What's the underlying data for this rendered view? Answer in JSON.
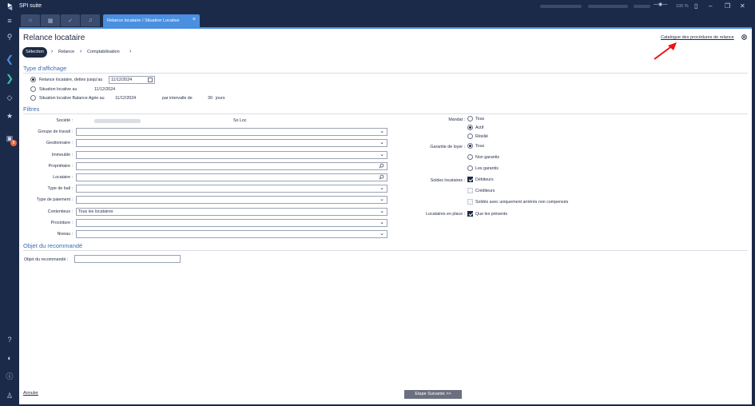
{
  "app": {
    "title": "SPI suite",
    "zoom": "100 %",
    "active_tab": "Relance locataire / Situation Locative",
    "tab_icons": [
      "home-icon",
      "calendar-icon",
      "check-icon",
      "bell-icon"
    ]
  },
  "sidebar": {
    "badge": "8",
    "icons": [
      "menu-icon",
      "search-icon",
      "arrow-left-icon",
      "arrow-right-icon",
      "code-icon",
      "star-icon",
      "bag-icon",
      "help-icon",
      "headset-icon",
      "info-icon",
      "user-icon"
    ]
  },
  "page": {
    "title": "Relance locataire",
    "catalogue_link": "Catalogue des procédures de relance",
    "steps": [
      "Sélection",
      "Relance",
      "Comptabilisation"
    ]
  },
  "type_affichage": {
    "heading": "Type d'affichage",
    "opt1": "Relance locataire, dettes jusqu'au",
    "opt1_date": "11/12/2024",
    "opt2": "Situation locative au",
    "opt2_date": "11/12/2024",
    "opt3": "Situation locative Balance Agée au",
    "opt3_date": "11/12/2024",
    "interval_label": "par intervalle de",
    "interval_value": "30",
    "interval_unit": "jours"
  },
  "filtres": {
    "heading": "Filtres",
    "societe_label": "Société :",
    "societe_extra": "So Loc",
    "groupe_label": "Groupe de travail :",
    "gestionnaire_label": "Gestionnaire :",
    "immeuble_label": "Immeuble :",
    "proprietaire_label": "Propriétaire :",
    "locataire_label": "Locataire :",
    "type_bail_label": "Type de bail :",
    "type_paiement_label": "Type de paiement :",
    "contentieux_label": "Contentieux :",
    "contentieux_value": "Tous les locataires",
    "procedure_label": "Procédure :",
    "niveau_label": "Niveau :"
  },
  "right": {
    "mandat_label": "Mandat :",
    "mandat_opts": [
      "Tous",
      "Actif",
      "Résilié"
    ],
    "garantie_label": "Garantie de loyer :",
    "garantie_opts": [
      "Tous",
      "Non garantis",
      "Les garantis"
    ],
    "soldes_label": "Soldes locataires :",
    "debiteurs": "Débiteurs",
    "crediteurs": "Créditeurs",
    "soldes_arrieres": "Soldés avec uniquement arriérés non compensés",
    "en_place_label": "Locataires en place :",
    "que_presents": "Que les présents"
  },
  "objet": {
    "heading": "Objet du recommandé",
    "label": "Objet du recommandé :"
  },
  "footer": {
    "cancel": "Annuler",
    "next": "Etape Suivante >>"
  }
}
